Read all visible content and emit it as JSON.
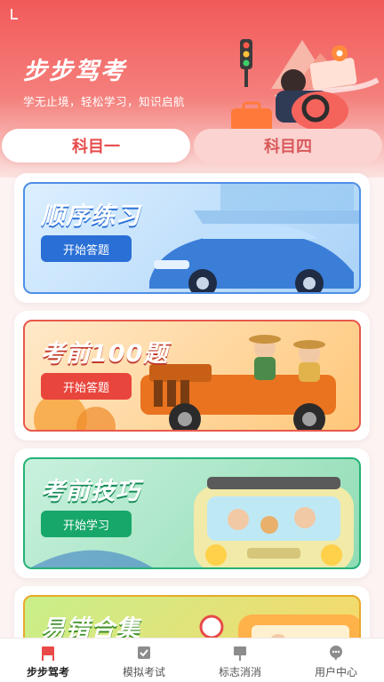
{
  "header": {
    "title": "步步驾考",
    "slogan": "学无止境，轻松学习，知识启航"
  },
  "subject_tabs": [
    {
      "label": "科目一",
      "active": true
    },
    {
      "label": "科目四",
      "active": false
    }
  ],
  "cards": [
    {
      "title": "顺序练习",
      "button": "开始答题",
      "accent": "#2a6fd6",
      "theme": "blue"
    },
    {
      "title": "考前100题",
      "button": "开始答题",
      "accent": "#e8453c",
      "theme": "orange"
    },
    {
      "title": "考前技巧",
      "button": "开始学习",
      "accent": "#18a76a",
      "theme": "green"
    },
    {
      "title": "易错合集",
      "theme": "yellow-green"
    }
  ],
  "bottom_nav": [
    {
      "label": "步步驾考",
      "icon": "flag-icon",
      "active": true
    },
    {
      "label": "模拟考试",
      "icon": "exam-check-icon",
      "active": false
    },
    {
      "label": "标志消消",
      "icon": "sign-board-icon",
      "active": false
    },
    {
      "label": "用户中心",
      "icon": "chat-bubble-icon",
      "active": false
    }
  ],
  "colors": {
    "primary": "#f25a5a",
    "active_tab_text": "#e84a4a",
    "inactive_tab_bg": "#fbd3d1"
  }
}
